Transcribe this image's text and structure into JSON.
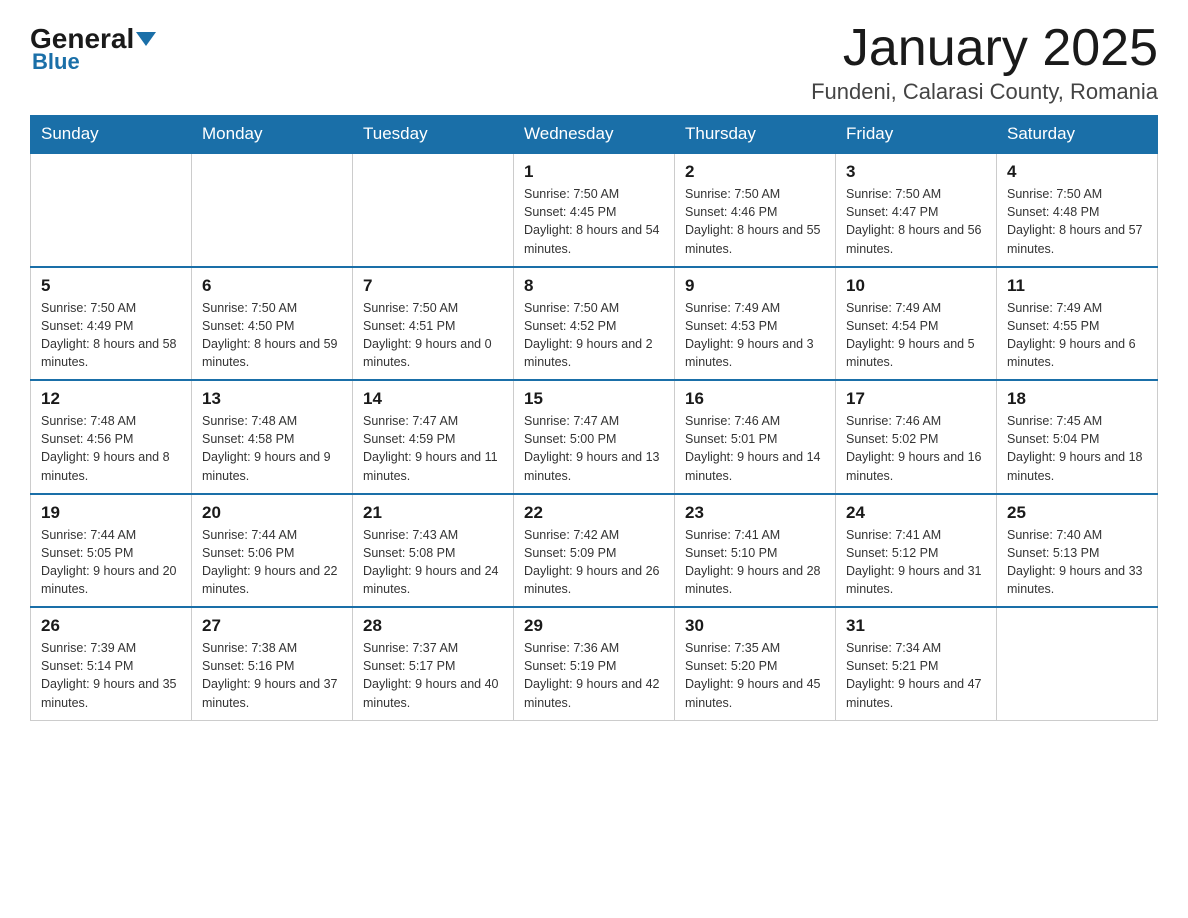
{
  "logo": {
    "general": "General",
    "blue": "Blue"
  },
  "header": {
    "month_title": "January 2025",
    "location": "Fundeni, Calarasi County, Romania"
  },
  "weekdays": [
    "Sunday",
    "Monday",
    "Tuesday",
    "Wednesday",
    "Thursday",
    "Friday",
    "Saturday"
  ],
  "weeks": [
    [
      {
        "day": "",
        "info": ""
      },
      {
        "day": "",
        "info": ""
      },
      {
        "day": "",
        "info": ""
      },
      {
        "day": "1",
        "info": "Sunrise: 7:50 AM\nSunset: 4:45 PM\nDaylight: 8 hours\nand 54 minutes."
      },
      {
        "day": "2",
        "info": "Sunrise: 7:50 AM\nSunset: 4:46 PM\nDaylight: 8 hours\nand 55 minutes."
      },
      {
        "day": "3",
        "info": "Sunrise: 7:50 AM\nSunset: 4:47 PM\nDaylight: 8 hours\nand 56 minutes."
      },
      {
        "day": "4",
        "info": "Sunrise: 7:50 AM\nSunset: 4:48 PM\nDaylight: 8 hours\nand 57 minutes."
      }
    ],
    [
      {
        "day": "5",
        "info": "Sunrise: 7:50 AM\nSunset: 4:49 PM\nDaylight: 8 hours\nand 58 minutes."
      },
      {
        "day": "6",
        "info": "Sunrise: 7:50 AM\nSunset: 4:50 PM\nDaylight: 8 hours\nand 59 minutes."
      },
      {
        "day": "7",
        "info": "Sunrise: 7:50 AM\nSunset: 4:51 PM\nDaylight: 9 hours\nand 0 minutes."
      },
      {
        "day": "8",
        "info": "Sunrise: 7:50 AM\nSunset: 4:52 PM\nDaylight: 9 hours\nand 2 minutes."
      },
      {
        "day": "9",
        "info": "Sunrise: 7:49 AM\nSunset: 4:53 PM\nDaylight: 9 hours\nand 3 minutes."
      },
      {
        "day": "10",
        "info": "Sunrise: 7:49 AM\nSunset: 4:54 PM\nDaylight: 9 hours\nand 5 minutes."
      },
      {
        "day": "11",
        "info": "Sunrise: 7:49 AM\nSunset: 4:55 PM\nDaylight: 9 hours\nand 6 minutes."
      }
    ],
    [
      {
        "day": "12",
        "info": "Sunrise: 7:48 AM\nSunset: 4:56 PM\nDaylight: 9 hours\nand 8 minutes."
      },
      {
        "day": "13",
        "info": "Sunrise: 7:48 AM\nSunset: 4:58 PM\nDaylight: 9 hours\nand 9 minutes."
      },
      {
        "day": "14",
        "info": "Sunrise: 7:47 AM\nSunset: 4:59 PM\nDaylight: 9 hours\nand 11 minutes."
      },
      {
        "day": "15",
        "info": "Sunrise: 7:47 AM\nSunset: 5:00 PM\nDaylight: 9 hours\nand 13 minutes."
      },
      {
        "day": "16",
        "info": "Sunrise: 7:46 AM\nSunset: 5:01 PM\nDaylight: 9 hours\nand 14 minutes."
      },
      {
        "day": "17",
        "info": "Sunrise: 7:46 AM\nSunset: 5:02 PM\nDaylight: 9 hours\nand 16 minutes."
      },
      {
        "day": "18",
        "info": "Sunrise: 7:45 AM\nSunset: 5:04 PM\nDaylight: 9 hours\nand 18 minutes."
      }
    ],
    [
      {
        "day": "19",
        "info": "Sunrise: 7:44 AM\nSunset: 5:05 PM\nDaylight: 9 hours\nand 20 minutes."
      },
      {
        "day": "20",
        "info": "Sunrise: 7:44 AM\nSunset: 5:06 PM\nDaylight: 9 hours\nand 22 minutes."
      },
      {
        "day": "21",
        "info": "Sunrise: 7:43 AM\nSunset: 5:08 PM\nDaylight: 9 hours\nand 24 minutes."
      },
      {
        "day": "22",
        "info": "Sunrise: 7:42 AM\nSunset: 5:09 PM\nDaylight: 9 hours\nand 26 minutes."
      },
      {
        "day": "23",
        "info": "Sunrise: 7:41 AM\nSunset: 5:10 PM\nDaylight: 9 hours\nand 28 minutes."
      },
      {
        "day": "24",
        "info": "Sunrise: 7:41 AM\nSunset: 5:12 PM\nDaylight: 9 hours\nand 31 minutes."
      },
      {
        "day": "25",
        "info": "Sunrise: 7:40 AM\nSunset: 5:13 PM\nDaylight: 9 hours\nand 33 minutes."
      }
    ],
    [
      {
        "day": "26",
        "info": "Sunrise: 7:39 AM\nSunset: 5:14 PM\nDaylight: 9 hours\nand 35 minutes."
      },
      {
        "day": "27",
        "info": "Sunrise: 7:38 AM\nSunset: 5:16 PM\nDaylight: 9 hours\nand 37 minutes."
      },
      {
        "day": "28",
        "info": "Sunrise: 7:37 AM\nSunset: 5:17 PM\nDaylight: 9 hours\nand 40 minutes."
      },
      {
        "day": "29",
        "info": "Sunrise: 7:36 AM\nSunset: 5:19 PM\nDaylight: 9 hours\nand 42 minutes."
      },
      {
        "day": "30",
        "info": "Sunrise: 7:35 AM\nSunset: 5:20 PM\nDaylight: 9 hours\nand 45 minutes."
      },
      {
        "day": "31",
        "info": "Sunrise: 7:34 AM\nSunset: 5:21 PM\nDaylight: 9 hours\nand 47 minutes."
      },
      {
        "day": "",
        "info": ""
      }
    ]
  ]
}
